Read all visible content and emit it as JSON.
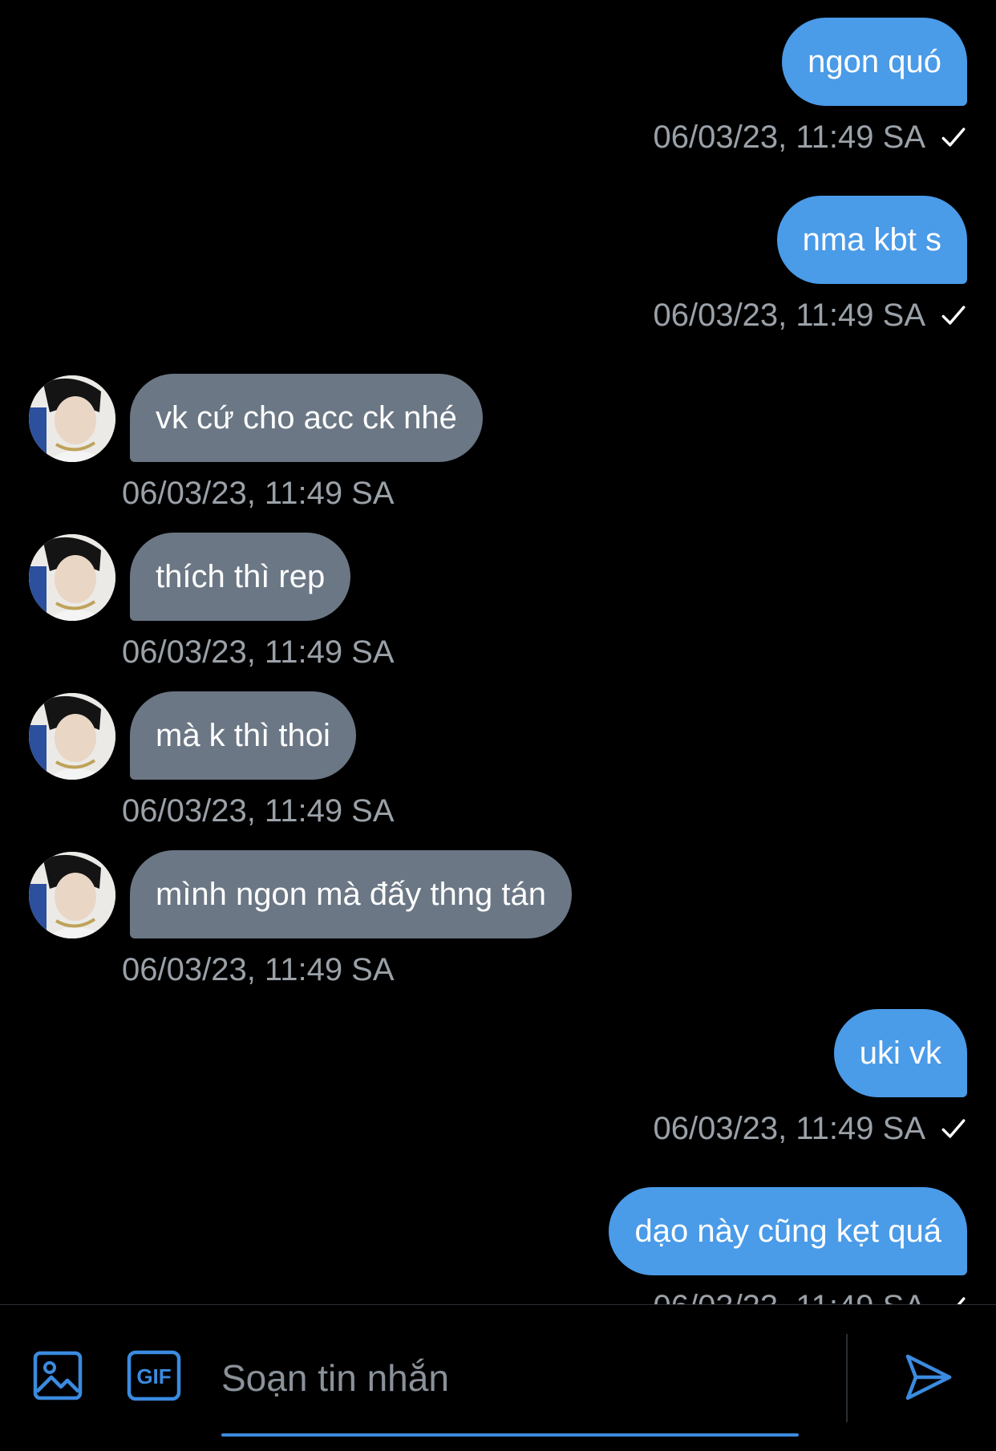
{
  "colors": {
    "outgoing_bubble": "#4a9be8",
    "incoming_bubble": "#6b7785",
    "background": "#000000",
    "timestamp": "#9aa1a8",
    "accent": "#3b8be0"
  },
  "messages": [
    {
      "direction": "out",
      "text": "ngon quó",
      "timestamp": "06/03/23, 11:49 SA",
      "status": "sent-check-icon"
    },
    {
      "direction": "out",
      "text": "nma kbt s",
      "timestamp": "06/03/23, 11:49 SA",
      "status": "sent-check-icon"
    },
    {
      "direction": "in",
      "text": "vk cứ cho acc ck nhé",
      "timestamp": "06/03/23, 11:49 SA"
    },
    {
      "direction": "in",
      "text": "thích thì rep",
      "timestamp": "06/03/23, 11:49 SA"
    },
    {
      "direction": "in",
      "text": "mà k thì thoi",
      "timestamp": "06/03/23, 11:49 SA"
    },
    {
      "direction": "in",
      "text": "mình ngon mà đấy thng tán",
      "timestamp": "06/03/23, 11:49 SA"
    },
    {
      "direction": "out",
      "text": "uki vk",
      "timestamp": "06/03/23, 11:49 SA",
      "status": "sent-check-icon"
    },
    {
      "direction": "out",
      "text": "dạo này cũng kẹt quá",
      "timestamp": "06/03/23, 11:49 SA",
      "status": "sent-check-icon"
    }
  ],
  "composer": {
    "placeholder": "Soạn tin nhắn",
    "image_button_icon": "image-icon",
    "gif_button_label": "GIF",
    "send_button_icon": "send-icon"
  }
}
